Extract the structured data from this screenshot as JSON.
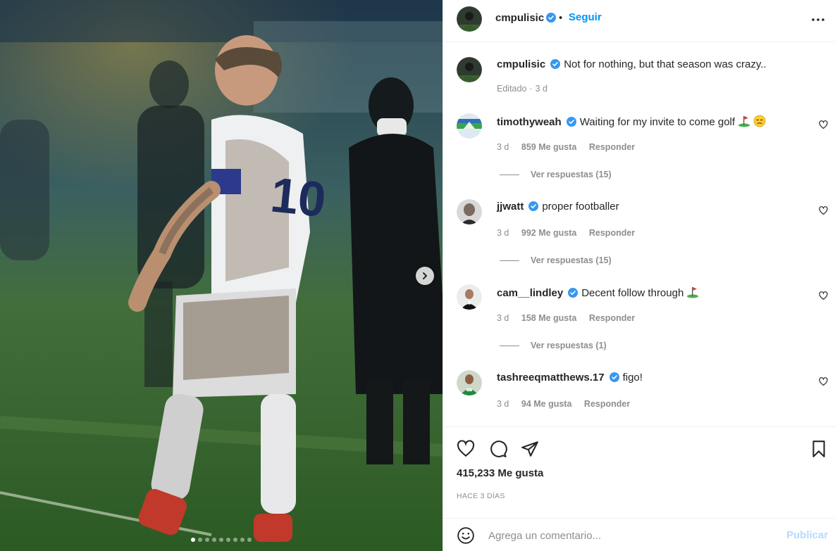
{
  "post": {
    "carousel": {
      "slide_count": 9,
      "active_index": 0
    }
  },
  "header": {
    "username": "cmpulisic",
    "separator": "•",
    "follow_label": "Seguir"
  },
  "caption": {
    "username": "cmpulisic",
    "text": "Not for nothing, but that season was crazy..",
    "meta_edited": "Editado",
    "meta_sep": "·",
    "meta_time": "3 d"
  },
  "comments": [
    {
      "username": "timothyweah",
      "text": "Waiting for my invite to come golf",
      "emoji": [
        "golf-flag",
        "unamused-face"
      ],
      "time": "3 d",
      "likes": "859 Me gusta",
      "reply": "Responder",
      "view_replies": "Ver respuestas (15)"
    },
    {
      "username": "jjwatt",
      "text": "proper footballer",
      "emoji": [],
      "time": "3 d",
      "likes": "992 Me gusta",
      "reply": "Responder",
      "view_replies": "Ver respuestas (15)"
    },
    {
      "username": "cam__lindley",
      "text": "Decent follow through",
      "emoji": [
        "golf-flag"
      ],
      "time": "3 d",
      "likes": "158 Me gusta",
      "reply": "Responder",
      "view_replies": "Ver respuestas (1)"
    },
    {
      "username": "tashreeqmatthews.17",
      "text": "figo!",
      "emoji": [],
      "time": "3 d",
      "likes": "94 Me gusta",
      "reply": "Responder",
      "view_replies": ""
    }
  ],
  "stats": {
    "likes": "415,233 Me gusta",
    "ago": "HACE 3 DÍAS"
  },
  "composer": {
    "placeholder": "Agrega un comentario...",
    "publish_label": "Publicar"
  },
  "colors": {
    "accent": "#0095f6",
    "verified": "#3897f0",
    "muted": "#8e8e8e",
    "publish_disabled": "#b3dbff"
  },
  "icons": [
    "verified-badge-icon",
    "more-options-icon",
    "heart-icon",
    "comment-icon",
    "share-icon",
    "bookmark-icon",
    "emoji-icon",
    "chevron-right-icon",
    "golf-flag-emoji",
    "unamused-emoji"
  ]
}
